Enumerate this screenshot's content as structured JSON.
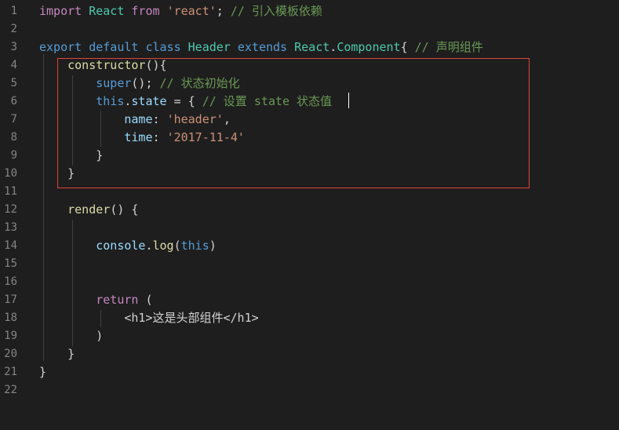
{
  "editor": {
    "lines": [
      {
        "n": "1",
        "tokens": [
          {
            "t": "import",
            "c": "kw2"
          },
          {
            "t": " ",
            "c": "plain"
          },
          {
            "t": "React",
            "c": "cls"
          },
          {
            "t": " ",
            "c": "plain"
          },
          {
            "t": "from",
            "c": "kw2"
          },
          {
            "t": " ",
            "c": "plain"
          },
          {
            "t": "'react'",
            "c": "str"
          },
          {
            "t": "; ",
            "c": "punc"
          },
          {
            "t": "// 引入模板依赖",
            "c": "com"
          }
        ]
      },
      {
        "n": "2",
        "tokens": []
      },
      {
        "n": "3",
        "tokens": [
          {
            "t": "export",
            "c": "kw"
          },
          {
            "t": " ",
            "c": "plain"
          },
          {
            "t": "default",
            "c": "kw"
          },
          {
            "t": " ",
            "c": "plain"
          },
          {
            "t": "class",
            "c": "kw"
          },
          {
            "t": " ",
            "c": "plain"
          },
          {
            "t": "Header",
            "c": "cls"
          },
          {
            "t": " ",
            "c": "plain"
          },
          {
            "t": "extends",
            "c": "kw"
          },
          {
            "t": " ",
            "c": "plain"
          },
          {
            "t": "React",
            "c": "cls"
          },
          {
            "t": ".",
            "c": "punc"
          },
          {
            "t": "Component",
            "c": "cls"
          },
          {
            "t": "{ ",
            "c": "punc"
          },
          {
            "t": "// 声明组件",
            "c": "com"
          }
        ]
      },
      {
        "n": "4",
        "tokens": [
          {
            "t": "    ",
            "c": "plain"
          },
          {
            "t": "constructor",
            "c": "fn"
          },
          {
            "t": "(){",
            "c": "punc"
          }
        ]
      },
      {
        "n": "5",
        "tokens": [
          {
            "t": "        ",
            "c": "plain"
          },
          {
            "t": "super",
            "c": "kw"
          },
          {
            "t": "(); ",
            "c": "punc"
          },
          {
            "t": "// 状态初始化",
            "c": "com"
          }
        ]
      },
      {
        "n": "6",
        "tokens": [
          {
            "t": "        ",
            "c": "plain"
          },
          {
            "t": "this",
            "c": "kw"
          },
          {
            "t": ".",
            "c": "punc"
          },
          {
            "t": "state",
            "c": "prop"
          },
          {
            "t": " = { ",
            "c": "punc"
          },
          {
            "t": "// 设置 state 状态值",
            "c": "com"
          }
        ]
      },
      {
        "n": "7",
        "tokens": [
          {
            "t": "            ",
            "c": "plain"
          },
          {
            "t": "name",
            "c": "prop"
          },
          {
            "t": ": ",
            "c": "punc"
          },
          {
            "t": "'header'",
            "c": "str"
          },
          {
            "t": ",",
            "c": "punc"
          }
        ]
      },
      {
        "n": "8",
        "tokens": [
          {
            "t": "            ",
            "c": "plain"
          },
          {
            "t": "time",
            "c": "prop"
          },
          {
            "t": ": ",
            "c": "punc"
          },
          {
            "t": "'2017-11-4'",
            "c": "str"
          }
        ]
      },
      {
        "n": "9",
        "tokens": [
          {
            "t": "        ",
            "c": "plain"
          },
          {
            "t": "}",
            "c": "punc"
          }
        ]
      },
      {
        "n": "10",
        "tokens": [
          {
            "t": "    ",
            "c": "plain"
          },
          {
            "t": "}",
            "c": "punc"
          }
        ]
      },
      {
        "n": "11",
        "tokens": []
      },
      {
        "n": "12",
        "tokens": [
          {
            "t": "    ",
            "c": "plain"
          },
          {
            "t": "render",
            "c": "fn"
          },
          {
            "t": "() {",
            "c": "punc"
          }
        ]
      },
      {
        "n": "13",
        "tokens": []
      },
      {
        "n": "14",
        "tokens": [
          {
            "t": "        ",
            "c": "plain"
          },
          {
            "t": "console",
            "c": "prop"
          },
          {
            "t": ".",
            "c": "punc"
          },
          {
            "t": "log",
            "c": "fn"
          },
          {
            "t": "(",
            "c": "punc"
          },
          {
            "t": "this",
            "c": "kw"
          },
          {
            "t": ")",
            "c": "punc"
          }
        ]
      },
      {
        "n": "15",
        "tokens": []
      },
      {
        "n": "16",
        "tokens": []
      },
      {
        "n": "17",
        "tokens": [
          {
            "t": "        ",
            "c": "plain"
          },
          {
            "t": "return",
            "c": "kw2"
          },
          {
            "t": " (",
            "c": "punc"
          }
        ]
      },
      {
        "n": "18",
        "tokens": [
          {
            "t": "            ",
            "c": "plain"
          },
          {
            "t": "<h1>这是头部组件</h1>",
            "c": "plain"
          }
        ]
      },
      {
        "n": "19",
        "tokens": [
          {
            "t": "        ",
            "c": "plain"
          },
          {
            "t": ")",
            "c": "punc"
          }
        ]
      },
      {
        "n": "20",
        "tokens": [
          {
            "t": "    ",
            "c": "plain"
          },
          {
            "t": "}",
            "c": "punc"
          }
        ]
      },
      {
        "n": "21",
        "tokens": [
          {
            "t": "}",
            "c": "punc"
          }
        ]
      },
      {
        "n": "22",
        "tokens": []
      }
    ]
  },
  "colors": {
    "background": "#1e1e1e",
    "highlight_border": "#e0443e"
  }
}
